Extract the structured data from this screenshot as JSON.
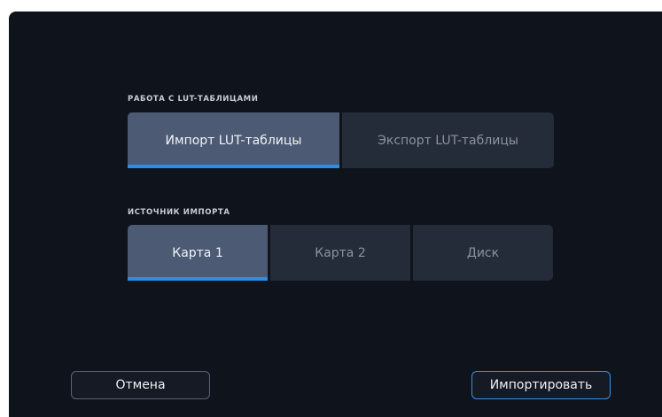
{
  "lut_section": {
    "label": "РАБОТА С LUT-ТАБЛИЦАМИ",
    "options": [
      {
        "label": "Импорт LUT-таблицы",
        "selected": true
      },
      {
        "label": "Экспорт LUT-таблицы",
        "selected": false
      }
    ]
  },
  "source_section": {
    "label": "ИСТОЧНИК ИМПОРТА",
    "options": [
      {
        "label": "Карта 1",
        "selected": true
      },
      {
        "label": "Карта 2",
        "selected": false
      },
      {
        "label": "Диск",
        "selected": false
      }
    ]
  },
  "footer": {
    "cancel_label": "Отмена",
    "import_label": "Импортировать"
  },
  "colors": {
    "background": "#0f131c",
    "segment_inactive": "#242b39",
    "segment_active": "#4d5a73",
    "accent": "#2a8fe8"
  }
}
